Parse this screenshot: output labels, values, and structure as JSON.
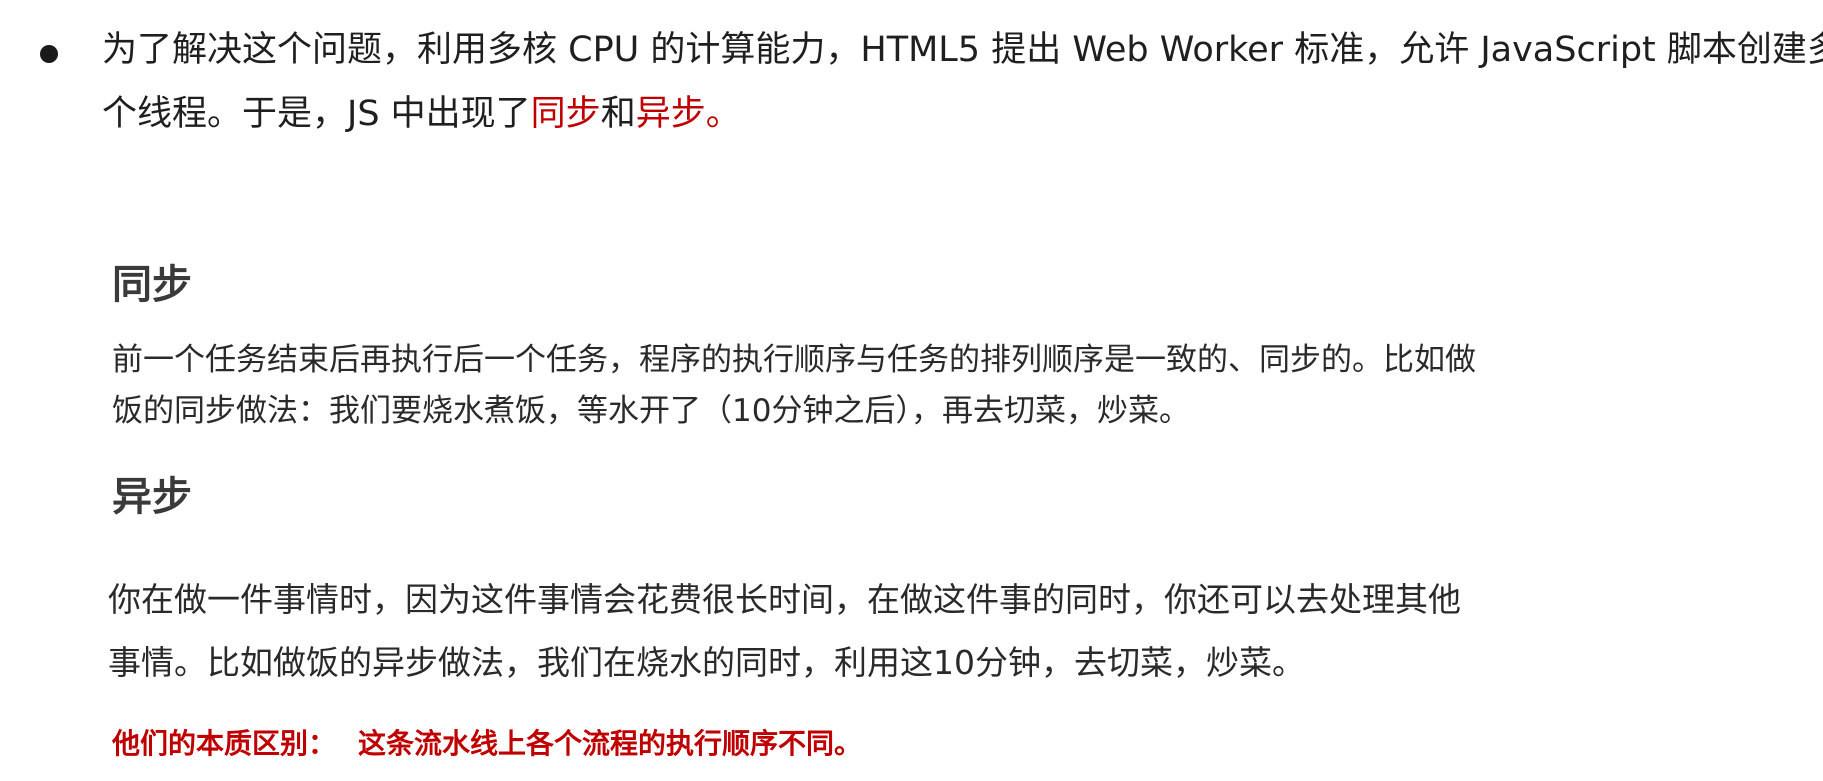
{
  "bullet": {
    "line1": "为了解决这个问题，利用多核 CPU 的计算能力，HTML5 提出 Web Worker 标准，允许 JavaScript 脚本创建多",
    "line2_prefix": "个线程。于是，JS 中出现了",
    "sync_word": "同步",
    "and_word": "和",
    "async_word": "异步",
    "end_mark": "。"
  },
  "sync": {
    "heading": "同步",
    "line1": "前一个任务结束后再执行后一个任务，程序的执行顺序与任务的排列顺序是一致的、同步的。比如做",
    "line2": "饭的同步做法：我们要烧水煮饭，等水开了（10分钟之后），再去切菜，炒菜。"
  },
  "async": {
    "heading": "异步",
    "line1": "你在做一件事情时，因为这件事情会花费很长时间，在做这件事的同时，你还可以去处理其他",
    "line2": "事情。比如做饭的异步做法，我们在烧水的同时，利用这10分钟，去切菜，炒菜。"
  },
  "conclusion": {
    "label": "他们的本质区别：",
    "text": "这条流水线上各个流程的执行顺序不同。"
  },
  "colors": {
    "accent_red": "#c00000",
    "text": "#222222",
    "heading": "#3a3a3a"
  }
}
